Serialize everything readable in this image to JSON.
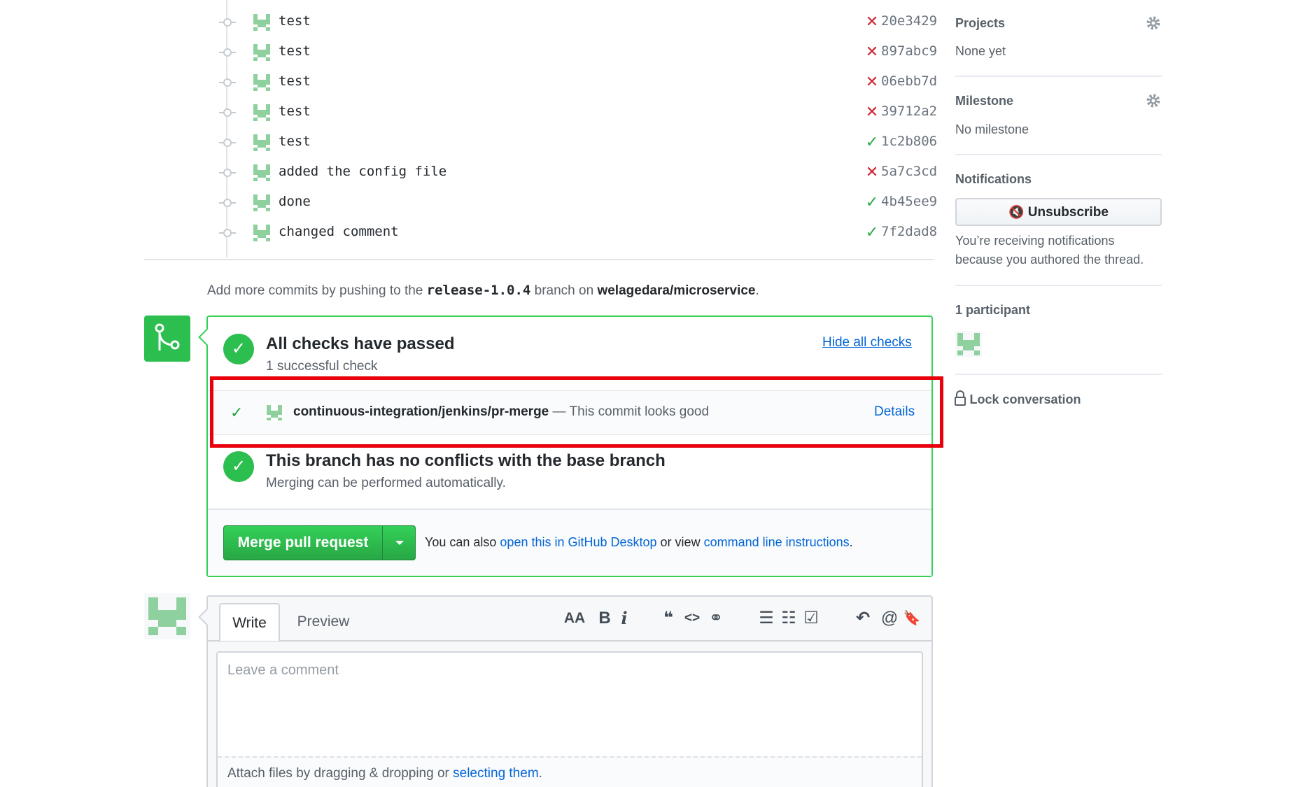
{
  "commits": [
    {
      "message": "test",
      "status": "fail",
      "sha": "20e3429"
    },
    {
      "message": "test",
      "status": "fail",
      "sha": "897abc9"
    },
    {
      "message": "test",
      "status": "fail",
      "sha": "06ebb7d"
    },
    {
      "message": "test",
      "status": "fail",
      "sha": "39712a2"
    },
    {
      "message": "test",
      "status": "ok",
      "sha": "1c2b806"
    },
    {
      "message": "added the config file",
      "status": "fail",
      "sha": "5a7c3cd"
    },
    {
      "message": "done",
      "status": "ok",
      "sha": "4b45ee9"
    },
    {
      "message": "changed comment",
      "status": "ok",
      "sha": "7f2dad8"
    }
  ],
  "add_more": {
    "prefix": "Add more commits by pushing to the ",
    "branch": "release-1.0.4",
    "middle": " branch on ",
    "repo": "welagedara/microservice",
    "suffix": "."
  },
  "checks": {
    "title": "All checks have passed",
    "subtitle": "1 successful check",
    "toggle_link": "Hide all checks",
    "item": {
      "context": "continuous-integration/jenkins/pr-merge",
      "description": " — This commit looks good",
      "details_link": "Details"
    }
  },
  "conflicts": {
    "title": "This branch has no conflicts with the base branch",
    "subtitle": "Merging can be performed automatically."
  },
  "merge": {
    "button_label": "Merge pull request",
    "also_prefix": "You can also ",
    "desktop_link": "open this in GitHub Desktop",
    "or_view": " or view ",
    "cli_link": "command line instructions",
    "suffix": "."
  },
  "comment": {
    "tab_write": "Write",
    "tab_preview": "Preview",
    "placeholder": "Leave a comment",
    "attach_prefix": "Attach files by dragging & dropping or ",
    "attach_link": "selecting them",
    "attach_suffix": ".",
    "toolbar": {
      "heading": "AA",
      "bold": "B",
      "italic": "i",
      "quote": "❝",
      "code": "<>",
      "link": "⚭",
      "ul": "☰",
      "ol": "☷",
      "tasks": "☑",
      "reply": "↶",
      "mention": "@",
      "saved": "🔖"
    }
  },
  "sidebar": {
    "projects_heading": "Projects",
    "projects_value": "None yet",
    "milestone_heading": "Milestone",
    "milestone_value": "No milestone",
    "notifications_heading": "Notifications",
    "unsubscribe_label": "Unsubscribe",
    "notifications_reason_1": "You’re receiving notifications",
    "notifications_reason_2": "because you authored the thread.",
    "participants_heading": "1 participant",
    "lock_label": "Lock conversation"
  },
  "colors": {
    "success": "#2cbe4e",
    "failure": "#cb2431",
    "link": "#0366d6",
    "highlight": "#e8000b",
    "avatar": "#8fd19e"
  }
}
